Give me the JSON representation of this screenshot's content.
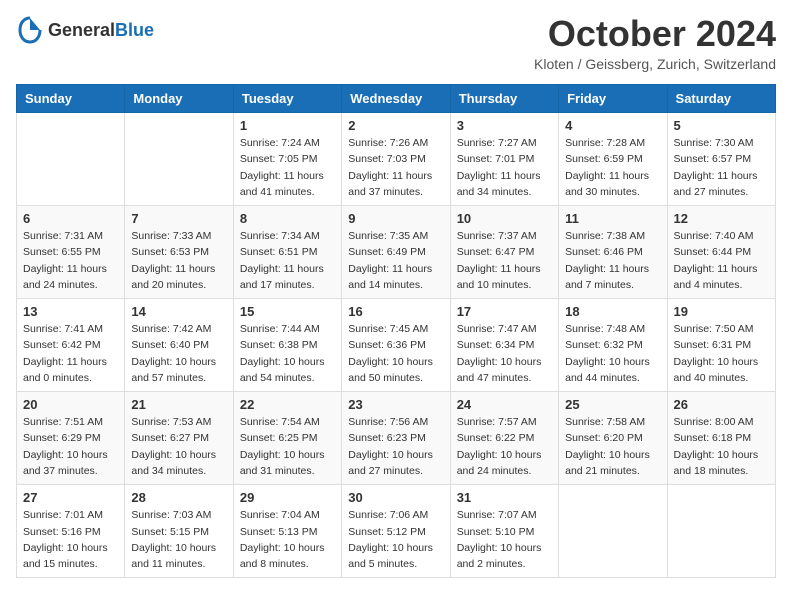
{
  "header": {
    "logo": {
      "general": "General",
      "blue": "Blue"
    },
    "title": "October 2024",
    "location": "Kloten / Geissberg, Zurich, Switzerland"
  },
  "calendar": {
    "weekdays": [
      "Sunday",
      "Monday",
      "Tuesday",
      "Wednesday",
      "Thursday",
      "Friday",
      "Saturday"
    ],
    "weeks": [
      [
        {
          "day": "",
          "info": ""
        },
        {
          "day": "",
          "info": ""
        },
        {
          "day": "1",
          "info": "Sunrise: 7:24 AM\nSunset: 7:05 PM\nDaylight: 11 hours\nand 41 minutes."
        },
        {
          "day": "2",
          "info": "Sunrise: 7:26 AM\nSunset: 7:03 PM\nDaylight: 11 hours\nand 37 minutes."
        },
        {
          "day": "3",
          "info": "Sunrise: 7:27 AM\nSunset: 7:01 PM\nDaylight: 11 hours\nand 34 minutes."
        },
        {
          "day": "4",
          "info": "Sunrise: 7:28 AM\nSunset: 6:59 PM\nDaylight: 11 hours\nand 30 minutes."
        },
        {
          "day": "5",
          "info": "Sunrise: 7:30 AM\nSunset: 6:57 PM\nDaylight: 11 hours\nand 27 minutes."
        }
      ],
      [
        {
          "day": "6",
          "info": "Sunrise: 7:31 AM\nSunset: 6:55 PM\nDaylight: 11 hours\nand 24 minutes."
        },
        {
          "day": "7",
          "info": "Sunrise: 7:33 AM\nSunset: 6:53 PM\nDaylight: 11 hours\nand 20 minutes."
        },
        {
          "day": "8",
          "info": "Sunrise: 7:34 AM\nSunset: 6:51 PM\nDaylight: 11 hours\nand 17 minutes."
        },
        {
          "day": "9",
          "info": "Sunrise: 7:35 AM\nSunset: 6:49 PM\nDaylight: 11 hours\nand 14 minutes."
        },
        {
          "day": "10",
          "info": "Sunrise: 7:37 AM\nSunset: 6:47 PM\nDaylight: 11 hours\nand 10 minutes."
        },
        {
          "day": "11",
          "info": "Sunrise: 7:38 AM\nSunset: 6:46 PM\nDaylight: 11 hours\nand 7 minutes."
        },
        {
          "day": "12",
          "info": "Sunrise: 7:40 AM\nSunset: 6:44 PM\nDaylight: 11 hours\nand 4 minutes."
        }
      ],
      [
        {
          "day": "13",
          "info": "Sunrise: 7:41 AM\nSunset: 6:42 PM\nDaylight: 11 hours\nand 0 minutes."
        },
        {
          "day": "14",
          "info": "Sunrise: 7:42 AM\nSunset: 6:40 PM\nDaylight: 10 hours\nand 57 minutes."
        },
        {
          "day": "15",
          "info": "Sunrise: 7:44 AM\nSunset: 6:38 PM\nDaylight: 10 hours\nand 54 minutes."
        },
        {
          "day": "16",
          "info": "Sunrise: 7:45 AM\nSunset: 6:36 PM\nDaylight: 10 hours\nand 50 minutes."
        },
        {
          "day": "17",
          "info": "Sunrise: 7:47 AM\nSunset: 6:34 PM\nDaylight: 10 hours\nand 47 minutes."
        },
        {
          "day": "18",
          "info": "Sunrise: 7:48 AM\nSunset: 6:32 PM\nDaylight: 10 hours\nand 44 minutes."
        },
        {
          "day": "19",
          "info": "Sunrise: 7:50 AM\nSunset: 6:31 PM\nDaylight: 10 hours\nand 40 minutes."
        }
      ],
      [
        {
          "day": "20",
          "info": "Sunrise: 7:51 AM\nSunset: 6:29 PM\nDaylight: 10 hours\nand 37 minutes."
        },
        {
          "day": "21",
          "info": "Sunrise: 7:53 AM\nSunset: 6:27 PM\nDaylight: 10 hours\nand 34 minutes."
        },
        {
          "day": "22",
          "info": "Sunrise: 7:54 AM\nSunset: 6:25 PM\nDaylight: 10 hours\nand 31 minutes."
        },
        {
          "day": "23",
          "info": "Sunrise: 7:56 AM\nSunset: 6:23 PM\nDaylight: 10 hours\nand 27 minutes."
        },
        {
          "day": "24",
          "info": "Sunrise: 7:57 AM\nSunset: 6:22 PM\nDaylight: 10 hours\nand 24 minutes."
        },
        {
          "day": "25",
          "info": "Sunrise: 7:58 AM\nSunset: 6:20 PM\nDaylight: 10 hours\nand 21 minutes."
        },
        {
          "day": "26",
          "info": "Sunrise: 8:00 AM\nSunset: 6:18 PM\nDaylight: 10 hours\nand 18 minutes."
        }
      ],
      [
        {
          "day": "27",
          "info": "Sunrise: 7:01 AM\nSunset: 5:16 PM\nDaylight: 10 hours\nand 15 minutes."
        },
        {
          "day": "28",
          "info": "Sunrise: 7:03 AM\nSunset: 5:15 PM\nDaylight: 10 hours\nand 11 minutes."
        },
        {
          "day": "29",
          "info": "Sunrise: 7:04 AM\nSunset: 5:13 PM\nDaylight: 10 hours\nand 8 minutes."
        },
        {
          "day": "30",
          "info": "Sunrise: 7:06 AM\nSunset: 5:12 PM\nDaylight: 10 hours\nand 5 minutes."
        },
        {
          "day": "31",
          "info": "Sunrise: 7:07 AM\nSunset: 5:10 PM\nDaylight: 10 hours\nand 2 minutes."
        },
        {
          "day": "",
          "info": ""
        },
        {
          "day": "",
          "info": ""
        }
      ]
    ]
  }
}
